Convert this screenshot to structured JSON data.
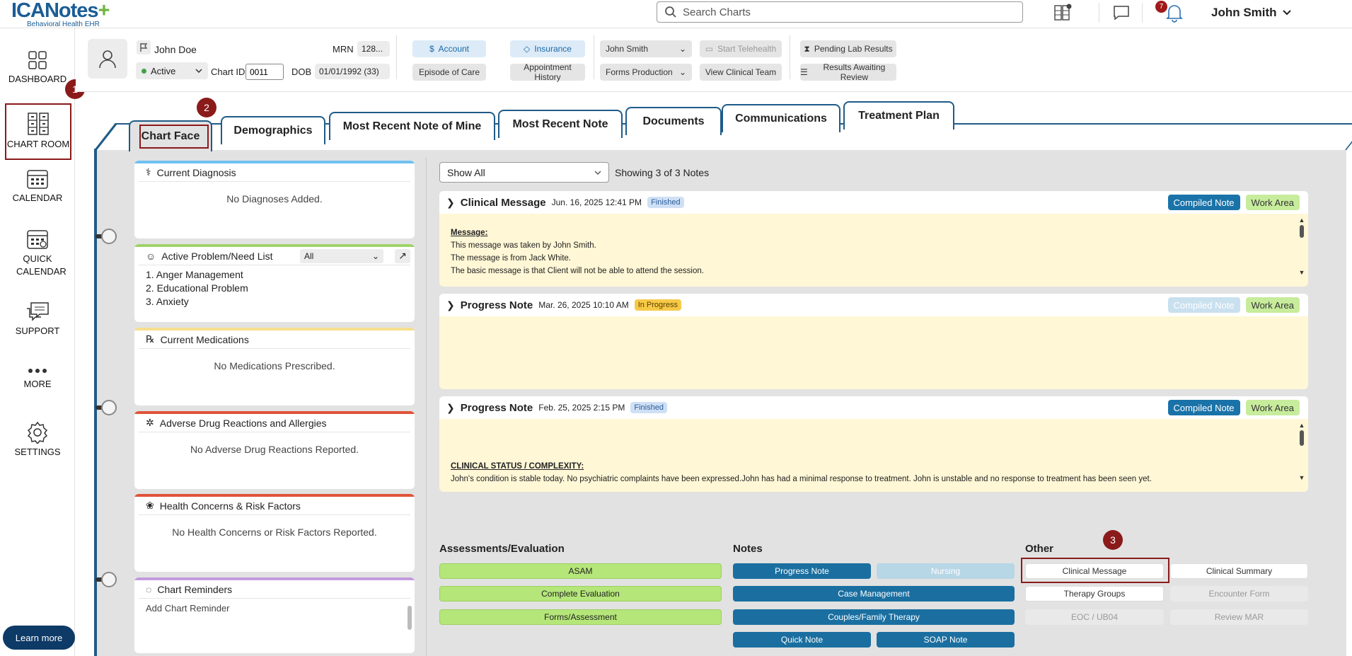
{
  "app": {
    "logo_main": "ICANotes",
    "logo_plus": "+",
    "logo_sub": "Behavioral Health EHR",
    "search_placeholder": "Search Charts",
    "notification_count": "7",
    "user_name": "John Smith"
  },
  "sidebar": {
    "items": [
      {
        "label": "DASHBOARD",
        "icon": "dashboard-icon"
      },
      {
        "label": "CHART ROOM",
        "icon": "file-cabinet-icon"
      },
      {
        "label": "CALENDAR",
        "icon": "calendar-icon"
      },
      {
        "label": "QUICK CALENDAR",
        "icon": "quick-calendar-icon"
      },
      {
        "label": "SUPPORT",
        "icon": "chat-support-icon"
      },
      {
        "label": "MORE",
        "icon": "more-dots-icon"
      },
      {
        "label": "SETTINGS",
        "icon": "gear-icon"
      }
    ],
    "learn_more": "Learn more"
  },
  "markers": [
    "1",
    "2",
    "3"
  ],
  "patient": {
    "name": "John Doe",
    "status": "Active",
    "chart_id_label": "Chart ID",
    "chart_id": "0011",
    "mrn_label": "MRN",
    "mrn": "128...",
    "dob_label": "DOB",
    "dob": "01/01/1992 (33)"
  },
  "header_buttons": {
    "account": "Account",
    "insurance": "Insurance",
    "episode": "Episode of Care",
    "appointment_history": "Appointment History",
    "provider": "John Smith",
    "forms_production": "Forms Production",
    "start_telehealth": "Start Telehealth",
    "view_clinical_team": "View Clinical Team",
    "pending_lab": "Pending Lab Results",
    "results_awaiting": "Results Awaiting Review"
  },
  "tabs": [
    "Chart Face",
    "Demographics",
    "Most Recent Note of Mine",
    "Most Recent Note",
    "Documents",
    "Communications",
    "Treatment Plan"
  ],
  "panels": {
    "diagnosis": {
      "title": "Current Diagnosis",
      "empty": "No Diagnoses Added."
    },
    "problems": {
      "title": "Active Problem/Need List",
      "filter": "All",
      "items": [
        "1. Anger Management",
        "2. Educational Problem",
        "3. Anxiety"
      ]
    },
    "medications": {
      "title": "Current Medications",
      "empty": "No Medications Prescribed."
    },
    "adverse": {
      "title": "Adverse Drug Reactions and Allergies",
      "empty": "No Adverse Drug Reactions Reported."
    },
    "health": {
      "title": "Health Concerns & Risk Factors",
      "empty": "No Health Concerns or Risk Factors Reported."
    },
    "reminders": {
      "title": "Chart Reminders",
      "placeholder": "Add Chart Reminder"
    }
  },
  "notes_filter": "Show All",
  "notes_count": "Showing 3 of 3 Notes",
  "notes": [
    {
      "title": "Clinical Message",
      "date": "Jun. 16, 2025 12:41 PM",
      "status": "Finished",
      "compiled": "Compiled Note",
      "work": "Work Area",
      "body_heading": "Message:",
      "body_lines": [
        "This message was taken by John Smith.",
        "The message is from Jack White.",
        "The basic message is that Client will not be able to attend the session."
      ]
    },
    {
      "title": "Progress Note",
      "date": "Mar. 26, 2025 10:10 AM",
      "status": "In Progress",
      "compiled": "Compiled Note",
      "work": "Work Area"
    },
    {
      "title": "Progress Note",
      "date": "Feb. 25, 2025 2:15 PM",
      "status": "Finished",
      "compiled": "Compiled Note",
      "work": "Work Area",
      "body_heading": "CLINICAL STATUS / COMPLEXITY:",
      "body_lines": [
        "John's condition is stable today. No psychiatric complaints have been expressed.John has had a minimal response to treatment. John is unstable and no response to treatment has been seen yet."
      ]
    }
  ],
  "sections": {
    "assessments": {
      "title": "Assessments/Evaluation",
      "buttons": [
        "ASAM",
        "Complete Evaluation",
        "Forms/Assessment"
      ]
    },
    "notes": {
      "title": "Notes",
      "buttons": [
        "Progress Note",
        "Nursing",
        "Case Management",
        "Couples/Family Therapy",
        "Quick Note",
        "SOAP Note"
      ]
    },
    "other": {
      "title": "Other",
      "buttons": [
        "Clinical Message",
        "Clinical Summary",
        "Therapy Groups",
        "Encounter Form",
        "EOC / UB04",
        "Review MAR"
      ]
    }
  }
}
